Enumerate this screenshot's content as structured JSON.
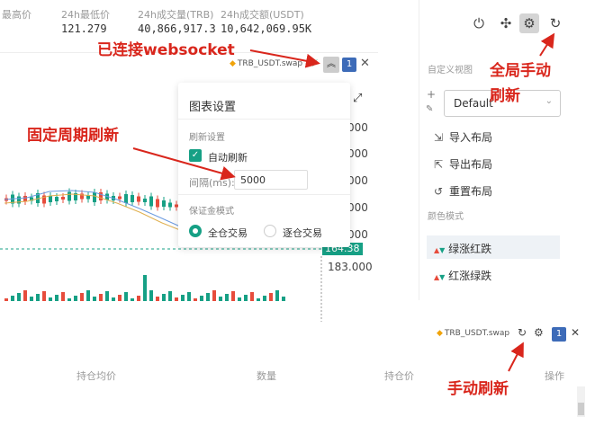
{
  "stats": {
    "labels": [
      "最高价",
      "24h最低价",
      "24h成交量(TRB)",
      "24h成交额(USDT)"
    ],
    "values": [
      "",
      "121.279",
      "40,866,917.3",
      "10,642,069.95K"
    ]
  },
  "chart_panel": {
    "symbol": "TRB_USDT.swap",
    "badge": "1",
    "price_labels": [
      "000",
      "000",
      "000",
      "000",
      "000"
    ],
    "current_price": "164.38",
    "lower_price": "183.000"
  },
  "popover": {
    "title": "图表设置",
    "refresh_section": "刷新设置",
    "auto_refresh_label": "自动刷新",
    "interval_label": "间隔(ms):",
    "interval_value": "5000",
    "margin_section": "保证金模式",
    "radio_cross": "全仓交易",
    "radio_isolated": "逐仓交易"
  },
  "sidebar": {
    "custom_view": "自定义视图",
    "layout_select": "Default",
    "import_layout": "导入布局",
    "export_layout": "导出布局",
    "reset_layout": "重置布局",
    "color_mode": "颜色模式",
    "color_options": [
      "绿涨红跌",
      "红涨绿跌"
    ]
  },
  "bottom_bar": {
    "symbol": "TRB_USDT.swap",
    "badge": "1"
  },
  "table_headers": [
    "持仓均价",
    "数量",
    "持仓价",
    "操作"
  ],
  "annotations": {
    "websocket": "已连接websocket",
    "global_refresh": "全局手动\n刷新",
    "global_refresh_line1": "全局手动",
    "global_refresh_line2": "刷新",
    "fixed_refresh": "固定周期刷新",
    "manual_refresh": "手动刷新"
  },
  "colors": {
    "up": "#16a085",
    "down": "#e74c3c",
    "annotation": "#d9261c",
    "accent": "#3d6bb8"
  }
}
